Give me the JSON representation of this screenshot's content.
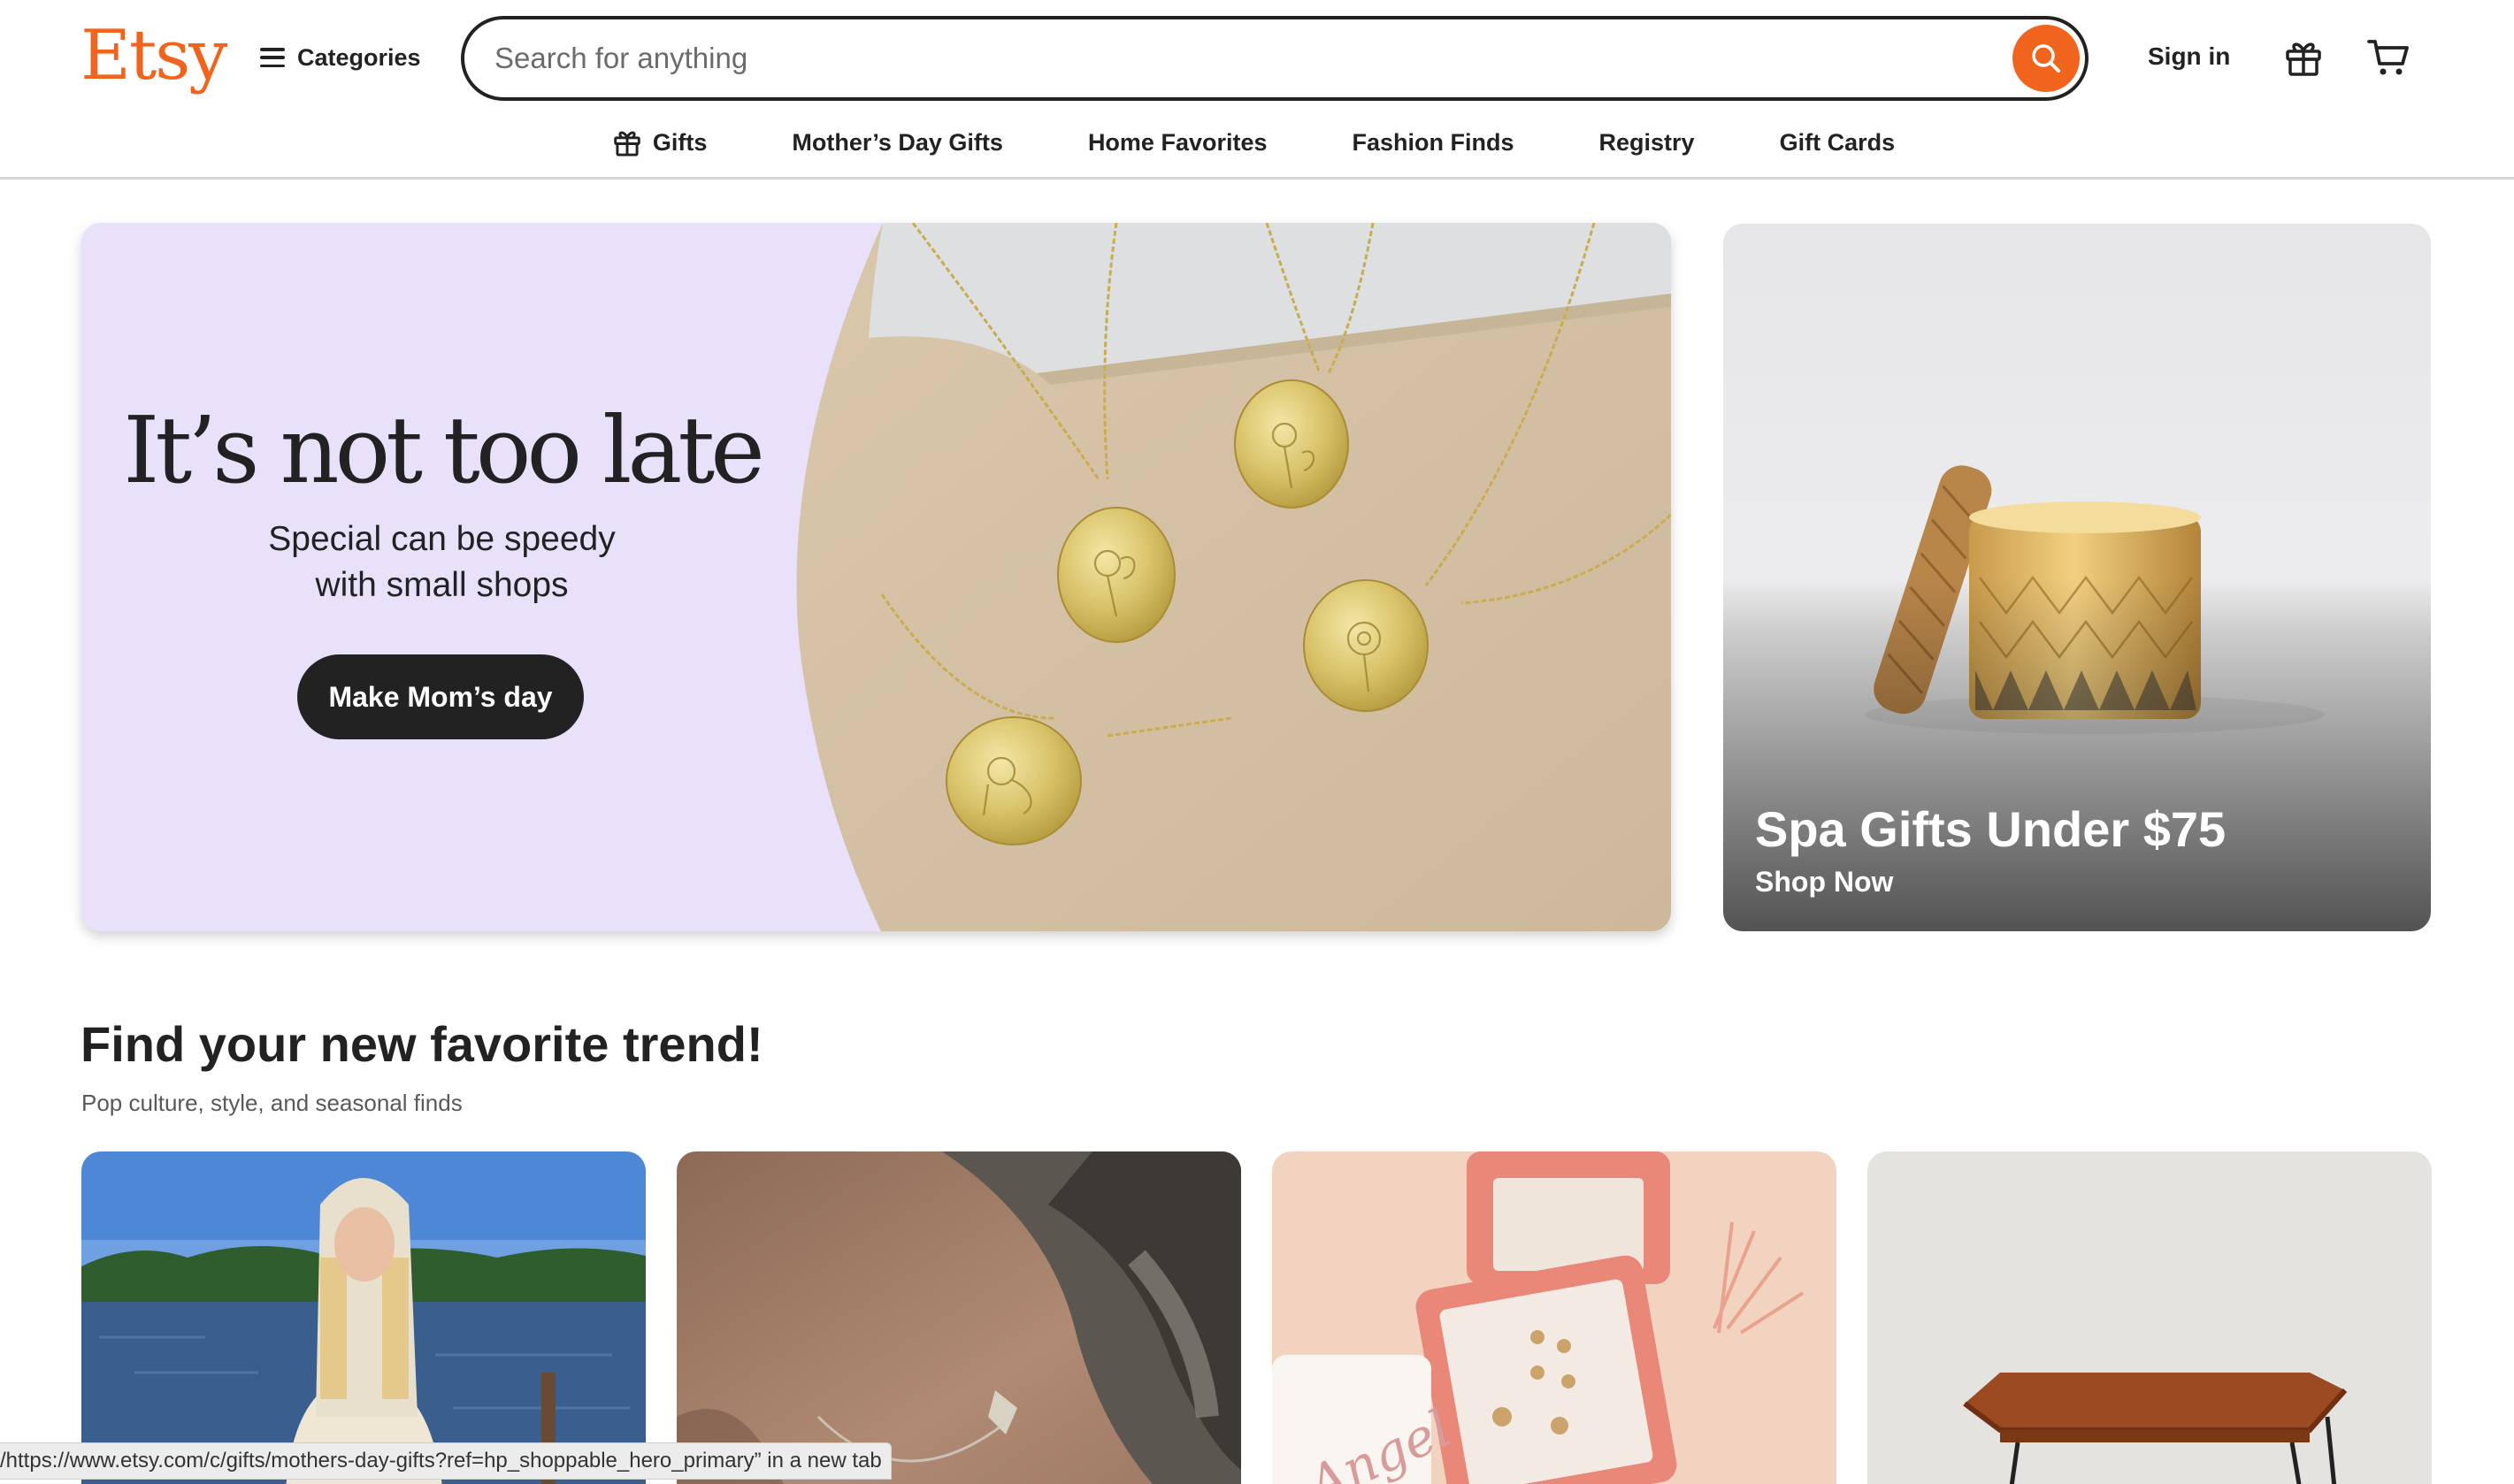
{
  "header": {
    "logo": "Etsy",
    "categories_label": "Categories",
    "search_placeholder": "Search for anything",
    "sign_in": "Sign in"
  },
  "subnav": {
    "items": [
      {
        "label": "Gifts",
        "icon": "gift-icon"
      },
      {
        "label": "Mother’s Day Gifts"
      },
      {
        "label": "Home Favorites"
      },
      {
        "label": "Fashion Finds"
      },
      {
        "label": "Registry"
      },
      {
        "label": "Gift Cards"
      }
    ]
  },
  "hero": {
    "title": "It’s not too late",
    "subtitle_line1": "Special can be speedy",
    "subtitle_line2": "with small shops",
    "cta": "Make Mom’s day"
  },
  "spa": {
    "title": "Spa Gifts Under $75",
    "link": "Shop Now"
  },
  "trends": {
    "title": "Find your new favorite trend!",
    "subtitle": "Pop culture, style, and seasonal finds",
    "card_text": "Angel"
  },
  "status_bar": {
    "text": "/https://www.etsy.com/c/gifts/mothers-day-gifts?ref=hp_shoppable_hero_primary” in a new tab"
  },
  "colors": {
    "brand": "#F1641E",
    "hero_bg": "#E9E0FA",
    "dark": "#222222"
  }
}
